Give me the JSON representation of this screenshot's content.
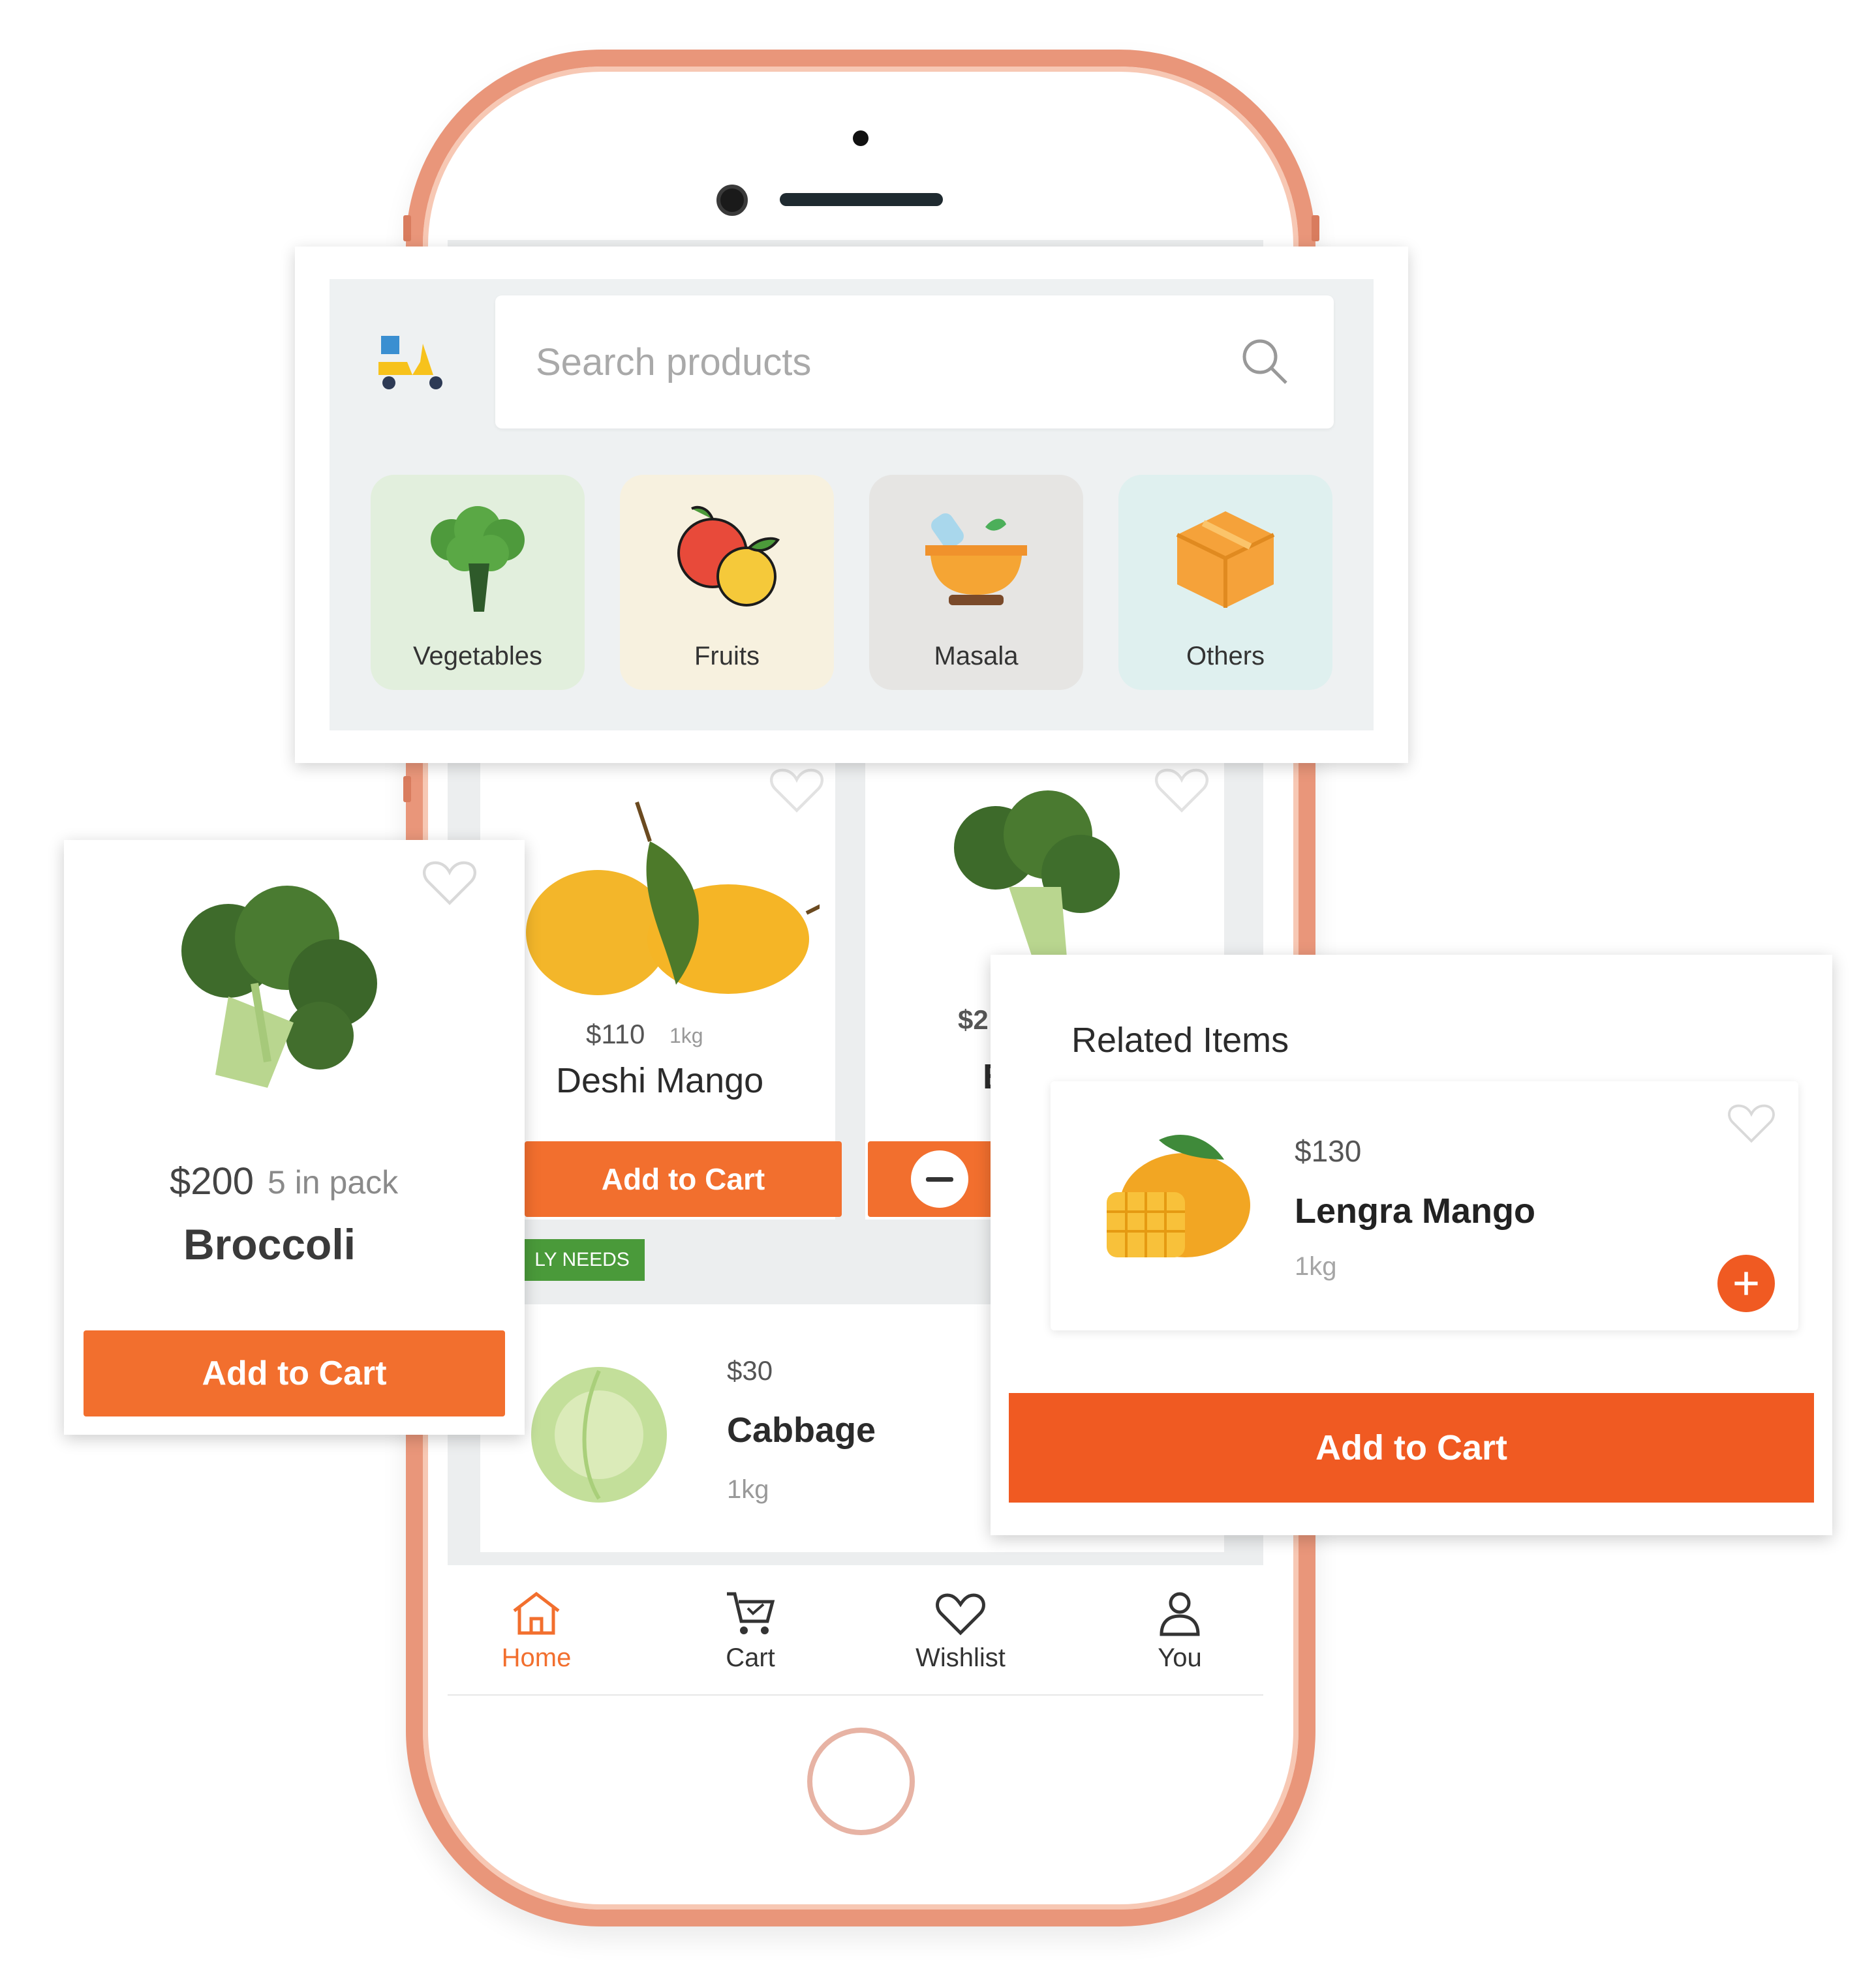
{
  "search": {
    "placeholder": "Search products"
  },
  "categories": [
    {
      "label": "Vegetables",
      "bg": "#e2efdd"
    },
    {
      "label": "Fruits",
      "bg": "#f7f1df"
    },
    {
      "label": "Masala",
      "bg": "#e6e5e3"
    },
    {
      "label": "Others",
      "bg": "#dff0ef"
    }
  ],
  "products": {
    "deshi_mango": {
      "price": "$110",
      "unit": "1kg",
      "name": "Deshi Mango",
      "button": "Add to Cart"
    },
    "second": {
      "price": "$2",
      "name": "E"
    },
    "section_tag": "LY NEEDS",
    "cabbage": {
      "price": "$30",
      "name": "Cabbage",
      "unit": "1kg"
    }
  },
  "broccoli_card": {
    "price": "$200",
    "unit": "5 in pack",
    "name": "Broccoli",
    "button": "Add to Cart"
  },
  "related": {
    "title": "Related Items",
    "item": {
      "price": "$130",
      "name": "Lengra Mango",
      "unit": "1kg"
    },
    "button": "Add to Cart"
  },
  "nav": [
    {
      "label": "Home",
      "icon": "home-icon",
      "active": true
    },
    {
      "label": "Cart",
      "icon": "cart-icon",
      "active": false
    },
    {
      "label": "Wishlist",
      "icon": "heart-icon",
      "active": false
    },
    {
      "label": "You",
      "icon": "user-icon",
      "active": false
    }
  ],
  "colors": {
    "accent": "#f26f2e",
    "phone_frame": "#e9967a",
    "tag_green": "#4a9a3a"
  }
}
